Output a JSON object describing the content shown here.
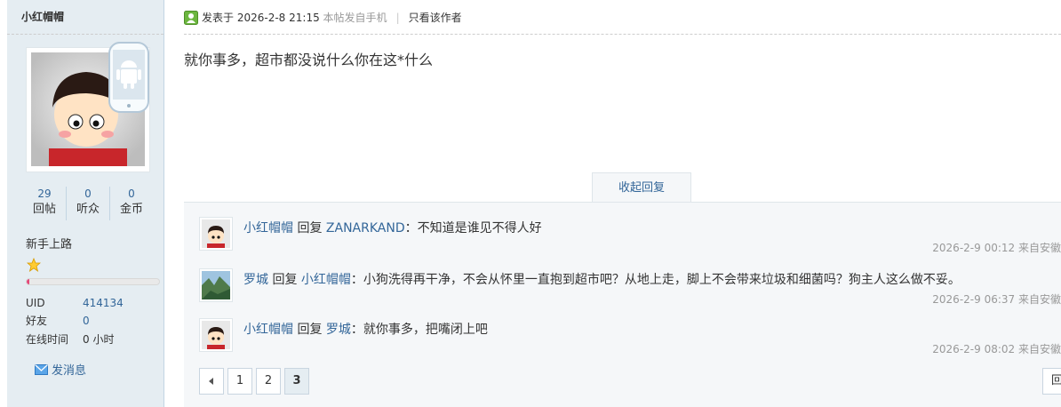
{
  "sidebar": {
    "username": "小红帽帽",
    "stats": [
      {
        "num": "29",
        "label": "回帖"
      },
      {
        "num": "0",
        "label": "听众"
      },
      {
        "num": "0",
        "label": "金币"
      }
    ],
    "level": "新手上路",
    "progress": 0.02,
    "info": [
      {
        "key": "UID",
        "value": "414134"
      },
      {
        "key": "好友",
        "value": "0"
      },
      {
        "key": "在线时间",
        "value": "0 小时"
      }
    ],
    "send_message": "发消息"
  },
  "post": {
    "posted_label": "发表于",
    "posted_time": "2026-2-8 21:15",
    "device": "本帖发自手机",
    "only_author": "只看该作者",
    "content": "就你事多，超市都没说什么你在这*什么"
  },
  "collapse_label": "收起回复",
  "replies": [
    {
      "author": "小红帽帽",
      "verb": "回复",
      "target": "ZANARKAND",
      "text": "：不知道是谁见不得人好",
      "time": "2026-2-9 00:12",
      "source": "来自安徽"
    },
    {
      "author": "罗城",
      "verb": "回复",
      "target": "小红帽帽",
      "text": "：小狗洗得再干净，不会从怀里一直抱到超市吧？从地上走，脚上不会带来垃圾和细菌吗？狗主人这么做不妥。",
      "time": "2026-2-9 06:37",
      "source": "来自安徽"
    },
    {
      "author": "小红帽帽",
      "verb": "回复",
      "target": "罗城",
      "text": "：就你事多，把嘴闭上吧",
      "time": "2026-2-9 08:02",
      "source": "来自安徽"
    }
  ],
  "pager": {
    "pages": [
      "1",
      "2",
      "3"
    ],
    "current": "3",
    "reply_button": "回"
  }
}
